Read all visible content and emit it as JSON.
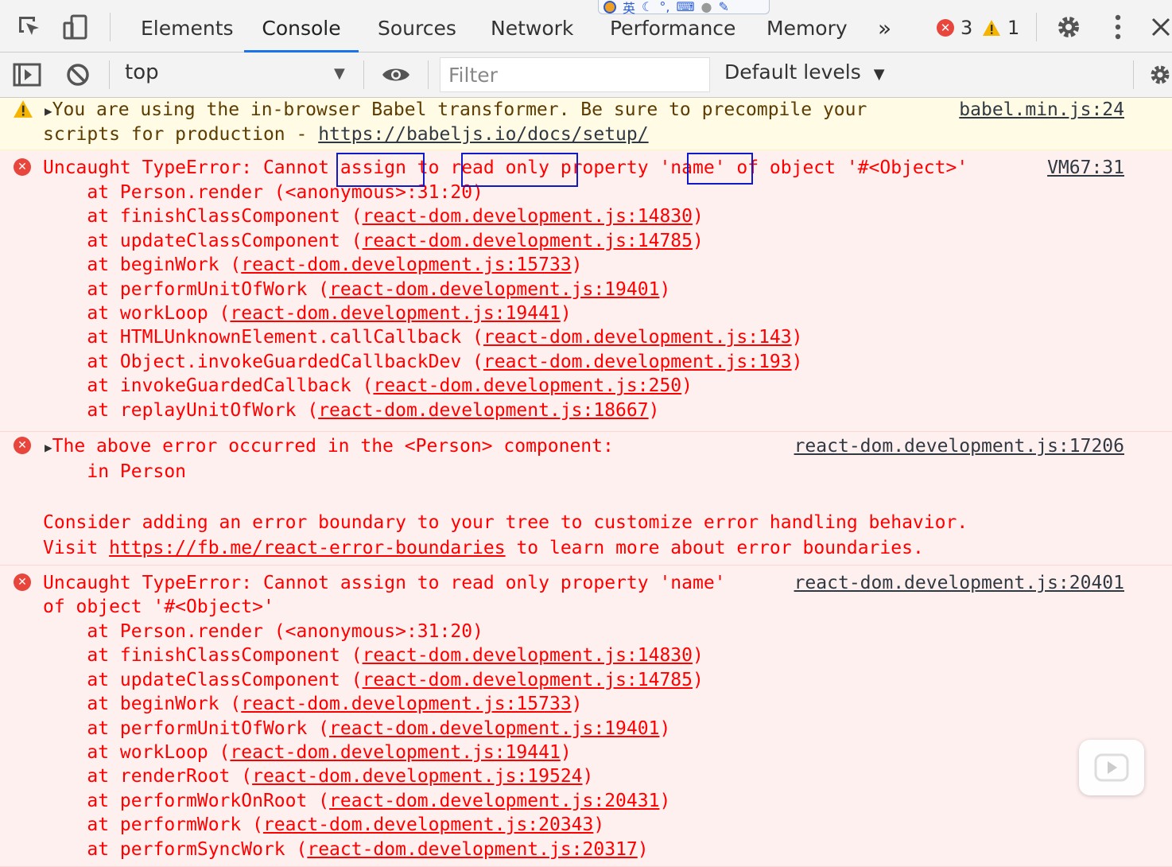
{
  "tabs": {
    "items": [
      "Elements",
      "Console",
      "Sources",
      "Network",
      "Performance",
      "Memory"
    ],
    "more": "»",
    "errors": "3",
    "warnings": "1"
  },
  "ime": {
    "label": "英"
  },
  "toolbar": {
    "context": "top",
    "filter_placeholder": "Filter",
    "levels": "Default levels"
  },
  "colors": {
    "accent": "#1a73e8",
    "error": "#fe0000",
    "error_bg": "#fff0f0",
    "warn_bg": "#fffbe5",
    "highlight": "#1019c9"
  },
  "messages": {
    "warn": {
      "line1": "You are using the in-browser Babel transformer. Be sure to precompile your",
      "line2_prefix": "scripts for production - ",
      "line2_link": "https://babeljs.io/docs/setup/",
      "source": "babel.min.js:24"
    },
    "err1": {
      "source": "VM67:31",
      "header": "Uncaught TypeError: Cannot assign to read only property 'name' of object '#<Object>'",
      "stack": [
        {
          "fn": "    at Person.render (",
          "file": "",
          "tail": "<anonymous>:31:20)"
        },
        {
          "fn": "    at finishClassComponent (",
          "file": "react-dom.development.js:14830",
          "tail": ")"
        },
        {
          "fn": "    at updateClassComponent (",
          "file": "react-dom.development.js:14785",
          "tail": ")"
        },
        {
          "fn": "    at beginWork (",
          "file": "react-dom.development.js:15733",
          "tail": ")"
        },
        {
          "fn": "    at performUnitOfWork (",
          "file": "react-dom.development.js:19401",
          "tail": ")"
        },
        {
          "fn": "    at workLoop (",
          "file": "react-dom.development.js:19441",
          "tail": ")"
        },
        {
          "fn": "    at HTMLUnknownElement.callCallback (",
          "file": "react-dom.development.js:143",
          "tail": ")"
        },
        {
          "fn": "    at Object.invokeGuardedCallbackDev (",
          "file": "react-dom.development.js:193",
          "tail": ")"
        },
        {
          "fn": "    at invokeGuardedCallback (",
          "file": "react-dom.development.js:250",
          "tail": ")"
        },
        {
          "fn": "    at replayUnitOfWork (",
          "file": "react-dom.development.js:18667",
          "tail": ")"
        }
      ]
    },
    "err2": {
      "source": "react-dom.development.js:17206",
      "line1": "The above error occurred in the <Person> component:",
      "line2": "    in Person",
      "line3": "Consider adding an error boundary to your tree to customize error handling behavior.",
      "line4_prefix": "Visit ",
      "line4_link": "https://fb.me/react-error-boundaries",
      "line4_suffix": " to learn more about error boundaries."
    },
    "err3": {
      "source": "react-dom.development.js:20401",
      "line1": "Uncaught TypeError: Cannot assign to read only property 'name'",
      "line2": "of object '#<Object>'",
      "stack": [
        {
          "fn": "    at Person.render (",
          "file": "",
          "tail": "<anonymous>:31:20)"
        },
        {
          "fn": "    at finishClassComponent (",
          "file": "react-dom.development.js:14830",
          "tail": ")"
        },
        {
          "fn": "    at updateClassComponent (",
          "file": "react-dom.development.js:14785",
          "tail": ")"
        },
        {
          "fn": "    at beginWork (",
          "file": "react-dom.development.js:15733",
          "tail": ")"
        },
        {
          "fn": "    at performUnitOfWork (",
          "file": "react-dom.development.js:19401",
          "tail": ")"
        },
        {
          "fn": "    at workLoop (",
          "file": "react-dom.development.js:19441",
          "tail": ")"
        },
        {
          "fn": "    at renderRoot (",
          "file": "react-dom.development.js:19524",
          "tail": ")"
        },
        {
          "fn": "    at performWorkOnRoot (",
          "file": "react-dom.development.js:20431",
          "tail": ")"
        },
        {
          "fn": "    at performWork (",
          "file": "react-dom.development.js:20343",
          "tail": ")"
        },
        {
          "fn": "    at performSyncWork (",
          "file": "react-dom.development.js:20317",
          "tail": ")"
        }
      ]
    }
  }
}
